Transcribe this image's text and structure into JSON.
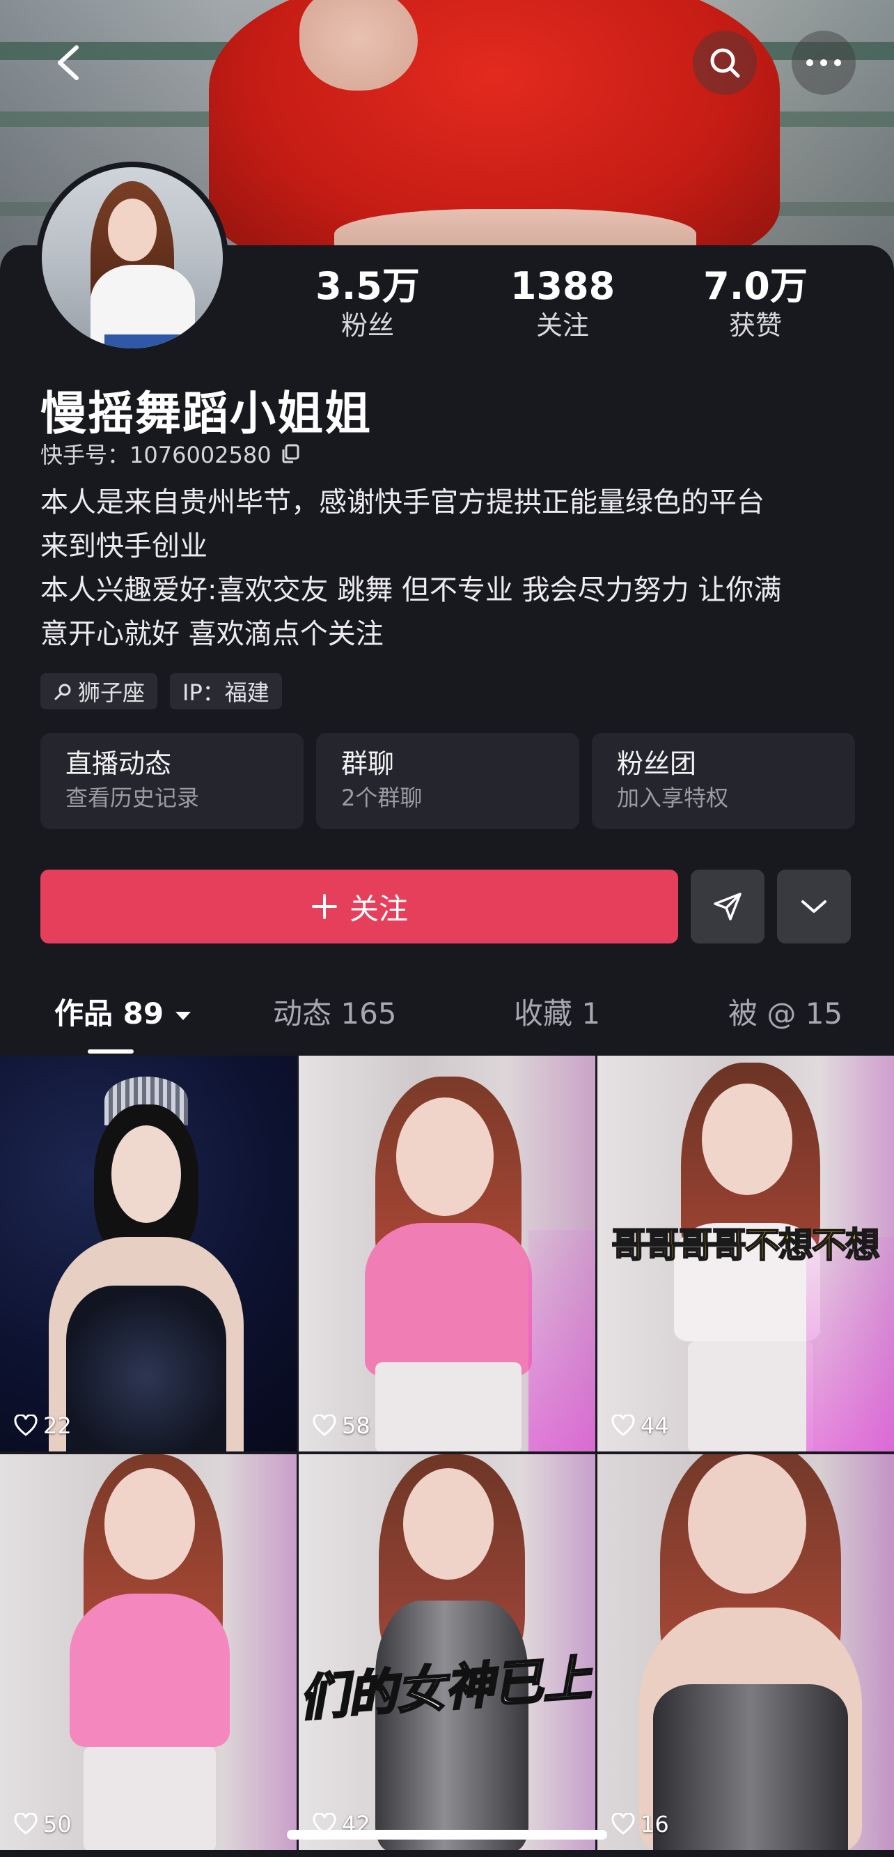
{
  "colors": {
    "accent": "#e53f5b",
    "background": "#18181f",
    "card": "#25252d"
  },
  "profile": {
    "name": "慢摇舞蹈小姐姐",
    "kuaishou_id": "快手号：1076002580",
    "bio_lines": [
      "本人是来自贵州毕节，感谢快手官方提拱正能量绿色的平台",
      "来到快手创业",
      "本人兴趣爱好:喜欢交友  跳舞 但不专业 我会尽力努力  让你满",
      "意开心就好 喜欢滴点个关注"
    ],
    "tags": [
      "狮子座",
      "IP：福建"
    ]
  },
  "stats": [
    {
      "value": "3.5万",
      "label": "粉丝"
    },
    {
      "value": "1388",
      "label": "关注"
    },
    {
      "value": "7.0万",
      "label": "获赞"
    }
  ],
  "cards": [
    {
      "title": "直播动态",
      "subtitle": "查看历史记录"
    },
    {
      "title": "群聊",
      "subtitle": "2个群聊"
    },
    {
      "title": "粉丝团",
      "subtitle": "加入享特权"
    }
  ],
  "actions": {
    "follow_label": "关注",
    "follow_icon": "plus-icon",
    "share_icon": "send-icon",
    "more_icon": "chevron-down-icon"
  },
  "tabs": [
    {
      "label": "作品 89"
    },
    {
      "label": "动态 165"
    },
    {
      "label": "收藏 1"
    },
    {
      "label": "被 @ 15"
    }
  ],
  "videos": [
    {
      "likes": "22"
    },
    {
      "likes": "58"
    },
    {
      "likes": "44",
      "overlay": "哥哥哥哥不想不想"
    },
    {
      "likes": "50"
    },
    {
      "likes": "42",
      "overlay": "们的女神已上"
    },
    {
      "likes": "16"
    }
  ]
}
